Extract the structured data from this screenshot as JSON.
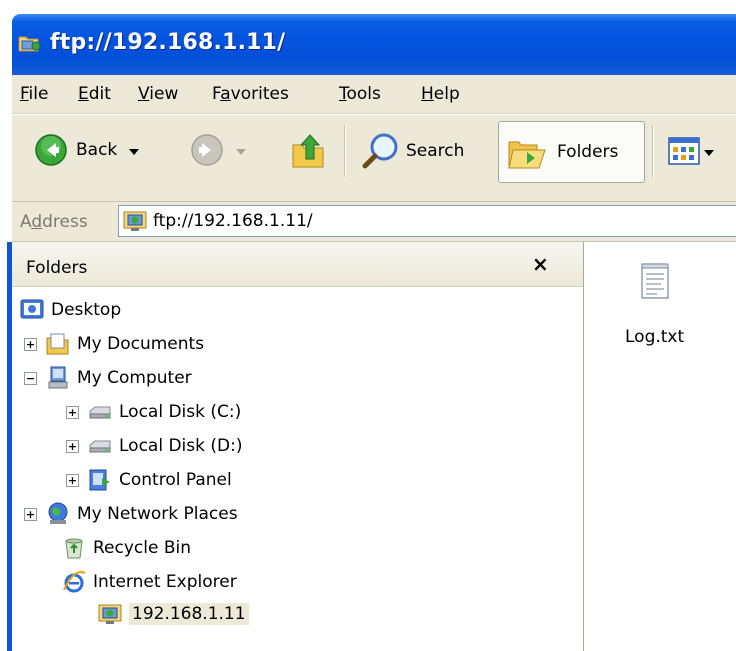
{
  "window": {
    "title": "ftp://192.168.1.11/",
    "icon": "ftp-folder-icon"
  },
  "menu": {
    "items": [
      {
        "label": "File",
        "underline": "F"
      },
      {
        "label": "Edit",
        "underline": "E"
      },
      {
        "label": "View",
        "underline": "V"
      },
      {
        "label": "Favorites",
        "underline": "a"
      },
      {
        "label": "Tools",
        "underline": "T"
      },
      {
        "label": "Help",
        "underline": "H"
      }
    ]
  },
  "toolbar": {
    "back_label": "Back",
    "search_label": "Search",
    "folders_label": "Folders"
  },
  "address": {
    "label": "Address",
    "value": "ftp://192.168.1.11/"
  },
  "folders_pane": {
    "title": "Folders",
    "close_glyph": "×",
    "tree": [
      {
        "label": "Desktop",
        "icon": "desktop-icon",
        "expander": null
      },
      {
        "label": "My Documents",
        "icon": "my-documents-icon",
        "expander": "+"
      },
      {
        "label": "My Computer",
        "icon": "my-computer-icon",
        "expander": "−"
      },
      {
        "label": "Local Disk (C:)",
        "icon": "local-disk-icon",
        "expander": "+"
      },
      {
        "label": "Local Disk (D:)",
        "icon": "local-disk-icon",
        "expander": "+"
      },
      {
        "label": "Control Panel",
        "icon": "control-panel-icon",
        "expander": "+"
      },
      {
        "label": "My Network Places",
        "icon": "network-places-icon",
        "expander": "+"
      },
      {
        "label": "Recycle Bin",
        "icon": "recycle-bin-icon",
        "expander": null
      },
      {
        "label": "Internet Explorer",
        "icon": "internet-explorer-icon",
        "expander": null
      },
      {
        "label": "192.168.1.11",
        "icon": "ftp-site-icon",
        "expander": null,
        "selected": true
      }
    ]
  },
  "files": [
    {
      "name": "Log.txt",
      "icon": "text-file-icon"
    }
  ],
  "colors": {
    "title_bar": "#0454e0",
    "chrome": "#ece9d8",
    "selection": "#ece9d8"
  }
}
